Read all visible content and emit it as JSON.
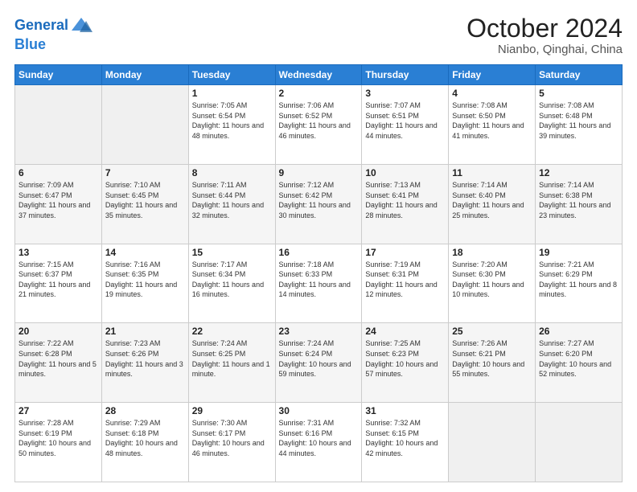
{
  "header": {
    "logo_line1": "General",
    "logo_line2": "Blue",
    "month": "October 2024",
    "location": "Nianbo, Qinghai, China"
  },
  "days_of_week": [
    "Sunday",
    "Monday",
    "Tuesday",
    "Wednesday",
    "Thursday",
    "Friday",
    "Saturday"
  ],
  "weeks": [
    [
      {
        "day": "",
        "info": ""
      },
      {
        "day": "",
        "info": ""
      },
      {
        "day": "1",
        "info": "Sunrise: 7:05 AM\nSunset: 6:54 PM\nDaylight: 11 hours and 48 minutes."
      },
      {
        "day": "2",
        "info": "Sunrise: 7:06 AM\nSunset: 6:52 PM\nDaylight: 11 hours and 46 minutes."
      },
      {
        "day": "3",
        "info": "Sunrise: 7:07 AM\nSunset: 6:51 PM\nDaylight: 11 hours and 44 minutes."
      },
      {
        "day": "4",
        "info": "Sunrise: 7:08 AM\nSunset: 6:50 PM\nDaylight: 11 hours and 41 minutes."
      },
      {
        "day": "5",
        "info": "Sunrise: 7:08 AM\nSunset: 6:48 PM\nDaylight: 11 hours and 39 minutes."
      }
    ],
    [
      {
        "day": "6",
        "info": "Sunrise: 7:09 AM\nSunset: 6:47 PM\nDaylight: 11 hours and 37 minutes."
      },
      {
        "day": "7",
        "info": "Sunrise: 7:10 AM\nSunset: 6:45 PM\nDaylight: 11 hours and 35 minutes."
      },
      {
        "day": "8",
        "info": "Sunrise: 7:11 AM\nSunset: 6:44 PM\nDaylight: 11 hours and 32 minutes."
      },
      {
        "day": "9",
        "info": "Sunrise: 7:12 AM\nSunset: 6:42 PM\nDaylight: 11 hours and 30 minutes."
      },
      {
        "day": "10",
        "info": "Sunrise: 7:13 AM\nSunset: 6:41 PM\nDaylight: 11 hours and 28 minutes."
      },
      {
        "day": "11",
        "info": "Sunrise: 7:14 AM\nSunset: 6:40 PM\nDaylight: 11 hours and 25 minutes."
      },
      {
        "day": "12",
        "info": "Sunrise: 7:14 AM\nSunset: 6:38 PM\nDaylight: 11 hours and 23 minutes."
      }
    ],
    [
      {
        "day": "13",
        "info": "Sunrise: 7:15 AM\nSunset: 6:37 PM\nDaylight: 11 hours and 21 minutes."
      },
      {
        "day": "14",
        "info": "Sunrise: 7:16 AM\nSunset: 6:35 PM\nDaylight: 11 hours and 19 minutes."
      },
      {
        "day": "15",
        "info": "Sunrise: 7:17 AM\nSunset: 6:34 PM\nDaylight: 11 hours and 16 minutes."
      },
      {
        "day": "16",
        "info": "Sunrise: 7:18 AM\nSunset: 6:33 PM\nDaylight: 11 hours and 14 minutes."
      },
      {
        "day": "17",
        "info": "Sunrise: 7:19 AM\nSunset: 6:31 PM\nDaylight: 11 hours and 12 minutes."
      },
      {
        "day": "18",
        "info": "Sunrise: 7:20 AM\nSunset: 6:30 PM\nDaylight: 11 hours and 10 minutes."
      },
      {
        "day": "19",
        "info": "Sunrise: 7:21 AM\nSunset: 6:29 PM\nDaylight: 11 hours and 8 minutes."
      }
    ],
    [
      {
        "day": "20",
        "info": "Sunrise: 7:22 AM\nSunset: 6:28 PM\nDaylight: 11 hours and 5 minutes."
      },
      {
        "day": "21",
        "info": "Sunrise: 7:23 AM\nSunset: 6:26 PM\nDaylight: 11 hours and 3 minutes."
      },
      {
        "day": "22",
        "info": "Sunrise: 7:24 AM\nSunset: 6:25 PM\nDaylight: 11 hours and 1 minute."
      },
      {
        "day": "23",
        "info": "Sunrise: 7:24 AM\nSunset: 6:24 PM\nDaylight: 10 hours and 59 minutes."
      },
      {
        "day": "24",
        "info": "Sunrise: 7:25 AM\nSunset: 6:23 PM\nDaylight: 10 hours and 57 minutes."
      },
      {
        "day": "25",
        "info": "Sunrise: 7:26 AM\nSunset: 6:21 PM\nDaylight: 10 hours and 55 minutes."
      },
      {
        "day": "26",
        "info": "Sunrise: 7:27 AM\nSunset: 6:20 PM\nDaylight: 10 hours and 52 minutes."
      }
    ],
    [
      {
        "day": "27",
        "info": "Sunrise: 7:28 AM\nSunset: 6:19 PM\nDaylight: 10 hours and 50 minutes."
      },
      {
        "day": "28",
        "info": "Sunrise: 7:29 AM\nSunset: 6:18 PM\nDaylight: 10 hours and 48 minutes."
      },
      {
        "day": "29",
        "info": "Sunrise: 7:30 AM\nSunset: 6:17 PM\nDaylight: 10 hours and 46 minutes."
      },
      {
        "day": "30",
        "info": "Sunrise: 7:31 AM\nSunset: 6:16 PM\nDaylight: 10 hours and 44 minutes."
      },
      {
        "day": "31",
        "info": "Sunrise: 7:32 AM\nSunset: 6:15 PM\nDaylight: 10 hours and 42 minutes."
      },
      {
        "day": "",
        "info": ""
      },
      {
        "day": "",
        "info": ""
      }
    ]
  ]
}
